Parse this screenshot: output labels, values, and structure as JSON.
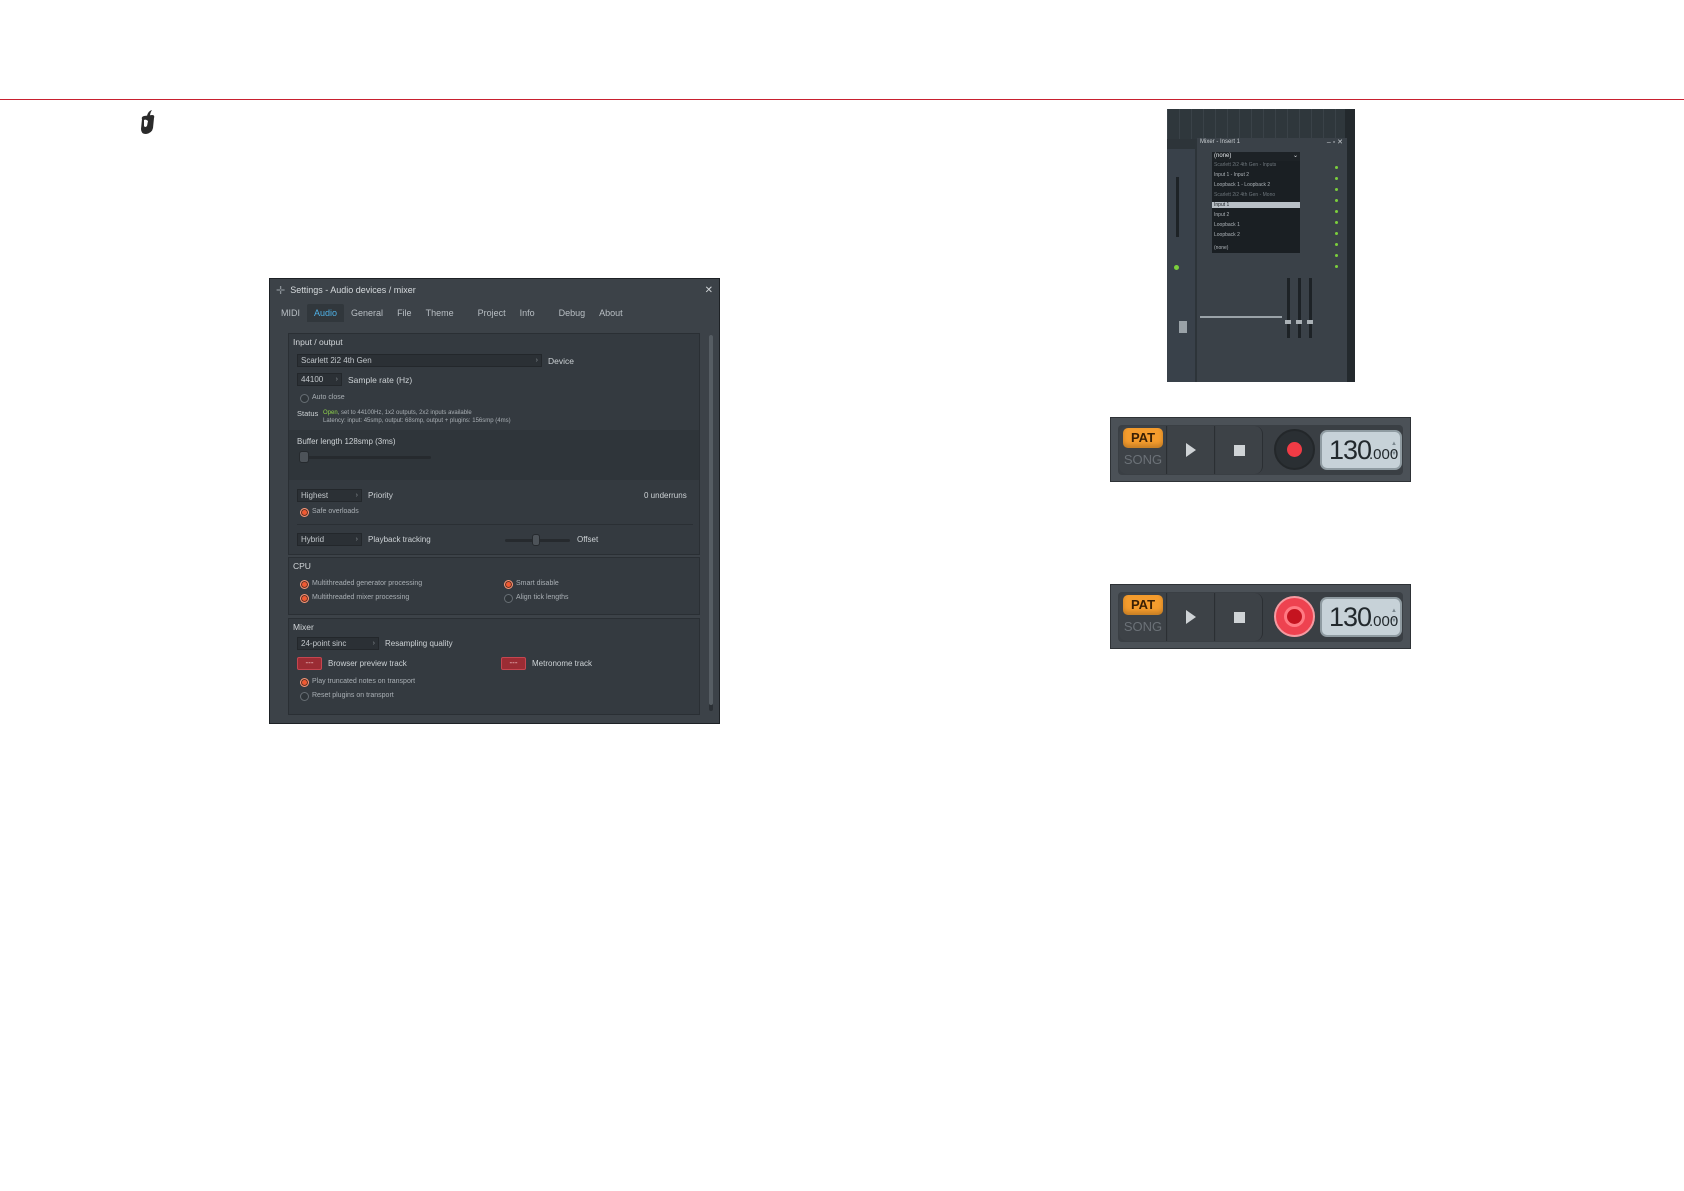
{
  "settings": {
    "title": "Settings - Audio devices / mixer",
    "tabs": [
      "MIDI",
      "Audio",
      "General",
      "File",
      "Theme",
      "Project",
      "Info",
      "Debug",
      "About"
    ],
    "active_tab": "Audio",
    "io": {
      "section": "Input / output",
      "device_value": "Scarlett 2i2 4th Gen",
      "device_label": "Device",
      "sample_rate_value": "44100",
      "sample_rate_label": "Sample rate (Hz)",
      "auto_close_label": "Auto close",
      "status_label": "Status",
      "status_open": "Open",
      "status_line1": ", set to 44100Hz, 1x2 outputs, 2x2 inputs available",
      "status_line2": "Latency: input: 45smp, output: 68smp, output + plugins: 156smp (4ms)",
      "buffer_label": "Buffer length 128smp (3ms)",
      "priority_value": "Highest",
      "priority_label": "Priority",
      "underruns": "0 underruns",
      "safe_overloads_label": "Safe overloads",
      "tracking_value": "Hybrid",
      "tracking_label": "Playback tracking",
      "offset_label": "Offset"
    },
    "cpu": {
      "section": "CPU",
      "opt1": "Multithreaded generator processing",
      "opt2": "Multithreaded mixer processing",
      "opt3": "Smart disable",
      "opt4": "Align tick lengths"
    },
    "mixer": {
      "section": "Mixer",
      "resampling_value": "24-point sinc",
      "resampling_label": "Resampling quality",
      "btn_placeholder": "---",
      "browser_label": "Browser preview track",
      "metronome_label": "Metronome track",
      "opt_truncated": "Play truncated notes on transport",
      "opt_reset": "Reset plugins on transport"
    }
  },
  "mixer_panel": {
    "title": "Mixer - Insert 1",
    "selected": "(none)",
    "items": [
      {
        "text": "Scarlett 2i2 4th Gen - Inputs",
        "kind": "hdr"
      },
      {
        "text": "Input 1 - Input 2",
        "kind": "item"
      },
      {
        "text": "Loopback 1 - Loopback 2",
        "kind": "item"
      },
      {
        "text": "Scarlett 2i2 4th Gen - Mono",
        "kind": "hdr"
      },
      {
        "text": "Input 1",
        "kind": "sel"
      },
      {
        "text": "Input 2",
        "kind": "item"
      },
      {
        "text": "Loopback 1",
        "kind": "item"
      },
      {
        "text": "Loopback 2",
        "kind": "item"
      },
      {
        "text": "(none)",
        "kind": "item"
      }
    ]
  },
  "transport": {
    "pat": "PAT",
    "song": "SONG",
    "tempo_int": "130",
    "tempo_frac": ".000"
  },
  "colors": {
    "accent_blue": "#4fb1e6",
    "radio_on": "#f05a33",
    "pat_orange": "#f59c2d",
    "record_red": "#ee4250"
  }
}
